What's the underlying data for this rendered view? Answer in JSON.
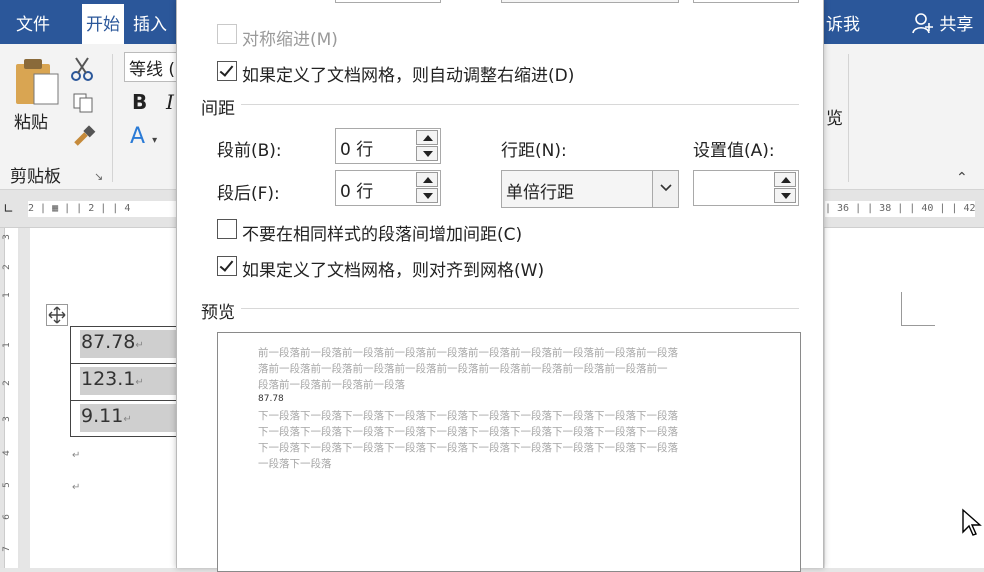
{
  "ribbon": {
    "tabs": [
      {
        "label": "文件"
      },
      {
        "label": "开始"
      },
      {
        "label": "插入"
      },
      {
        "label": "诉我"
      },
      {
        "label": "共享"
      }
    ],
    "paste_label": "粘贴",
    "clipboard_group": "剪贴板",
    "font_name": "等线 (",
    "bold_label": "B",
    "italic_label": "I",
    "color_label": "A",
    "partial_right_label": "览"
  },
  "ruler": {
    "left_ticks": "2 | ▦ |  | 2 |  | 4",
    "right_ticks": "| 36 |   | 38 |   | 40 |   | 42 |",
    "vertical_numbers": [
      "3",
      "2",
      "1",
      "1",
      "2",
      "3",
      "4",
      "5",
      "6",
      "7"
    ]
  },
  "document": {
    "cells": [
      "87.78",
      "123.1",
      "9.11"
    ],
    "paragraph_mark": "↵"
  },
  "dialog": {
    "symmetric_indent": {
      "label": "对称缩进(M)",
      "checked": false,
      "disabled": true
    },
    "auto_right_indent": {
      "label": "如果定义了文档网格，则自动调整右缩进(D)",
      "checked": true
    },
    "spacing_section": "间距",
    "before_label": "段前(B):",
    "before_value": "0 行",
    "after_label": "段后(F):",
    "after_value": "0 行",
    "line_spacing_label": "行距(N):",
    "line_spacing_value": "单倍行距",
    "at_label": "设置值(A):",
    "at_value": "",
    "no_space_same_style": {
      "label": "不要在相同样式的段落间增加间距(C)",
      "checked": false
    },
    "snap_to_grid": {
      "label": "如果定义了文档网格，则对齐到网格(W)",
      "checked": true
    },
    "preview_section": "预览",
    "preview": {
      "prev_lines": [
        "前一段落前一段落前一段落前一段落前一段落前一段落前一段落前一段落前一段落前一段落",
        "落前一段落前一段落前一段落前一段落前一段落前一段落前一段落前一段落前一段落前一",
        "段落前一段落前一段落前一段落"
      ],
      "current": "87.78",
      "next_lines": [
        "下一段落下一段落下一段落下一段落下一段落下一段落下一段落下一段落下一段落下一段落",
        "下一段落下一段落下一段落下一段落下一段落下一段落下一段落下一段落下一段落下一段落",
        "下一段落下一段落下一段落下一段落下一段落下一段落下一段落下一段落下一段落下一段落",
        "一段落下一段落"
      ]
    }
  },
  "colors": {
    "ribbon_blue": "#2b579a",
    "preview_gray": "#a6a6a6"
  }
}
